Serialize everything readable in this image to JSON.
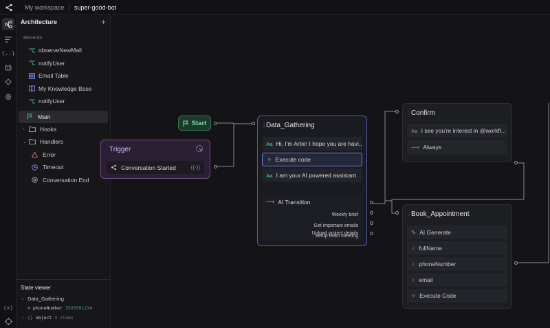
{
  "breadcrumb": {
    "workspace": "My workspace",
    "bot": "super-good-bot"
  },
  "sidebar": {
    "title": "Architecture",
    "recents_label": "Recents",
    "recents": [
      {
        "label": "observeNewMail",
        "icon": "workflow-icon"
      },
      {
        "label": "notifyUser",
        "icon": "workflow-icon"
      },
      {
        "label": "Email Table",
        "icon": "table-icon"
      },
      {
        "label": "My Knowledge Base",
        "icon": "book-icon"
      },
      {
        "label": "notifyUser",
        "icon": "workflow-icon"
      }
    ],
    "main": "Main",
    "hooks": "Hooks",
    "handlers": "Handlers",
    "handler_items": [
      "Error",
      "Timeout",
      "Conversation End"
    ]
  },
  "state_viewer": {
    "title": "State viewer",
    "node": "Data_Gathering",
    "var_name": "phoneNumber",
    "var_value": "3593591234",
    "obj_label": "object",
    "obj_count": "4 items"
  },
  "canvas": {
    "start_label": "Start",
    "trigger": {
      "title": "Trigger",
      "event": "Conversation Started"
    },
    "data_gathering": {
      "title": "Data_Gathering",
      "rows": [
        "Hi, I'm Artie! I hope you are havi...",
        "Execute code",
        "I am your AI powered assistant",
        "AI Transition"
      ],
      "choices": [
        "Weekly brief",
        "Get important emails",
        "Setup team meeting",
        "Upload project details"
      ]
    },
    "confirm": {
      "title": "Confirm",
      "rows": [
        "I see you're interest in @workfl...",
        "Always"
      ]
    },
    "book_appointment": {
      "title": "Book_Appointment",
      "rows": [
        "AI Generate",
        "fullName",
        "phoneNumber",
        "email",
        "Execute Code"
      ]
    }
  },
  "colors": {
    "accent_blue": "#4c5bb0",
    "trigger_purple": "#6b4b86",
    "start_green": "#2f7a55",
    "text_green": "#3fae8a"
  }
}
